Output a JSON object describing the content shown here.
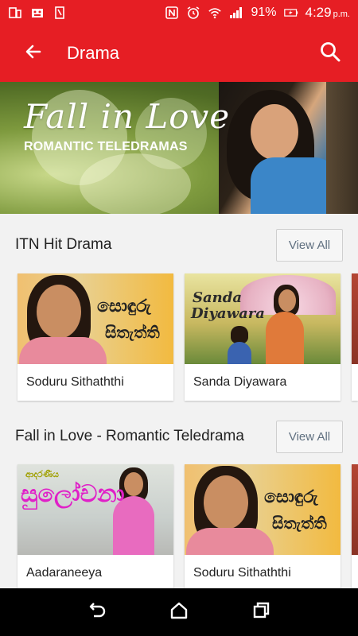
{
  "status_bar": {
    "battery": "91%",
    "time": "4:29",
    "ampm": "p.m."
  },
  "app_bar": {
    "title": "Drama"
  },
  "banner": {
    "title": "Fall in Love",
    "subtitle": "ROMANTIC TELEDRAMAS"
  },
  "sections": [
    {
      "title": "ITN Hit Drama",
      "view_all": "View All",
      "items": [
        {
          "label": "Soduru Sithaththi"
        },
        {
          "label": "Sanda Diyawara"
        }
      ]
    },
    {
      "title": "Fall in Love - Romantic Teledrama",
      "view_all": "View All",
      "items": [
        {
          "label": "Aadaraneeya"
        },
        {
          "label": "Soduru Sithaththi"
        }
      ]
    }
  ],
  "thumb_text": {
    "soduru_1": "සොඳුරු",
    "soduru_2": "සිතැත්ති",
    "sanda_1": "Sanda",
    "sanda_2": "Diyawara",
    "aada_small": "ආදරණීය",
    "aada_big": "සුලෝචනා"
  },
  "colors": {
    "primary": "#e61e24",
    "nav_bar": "#000000",
    "background": "#f2f2f2"
  }
}
